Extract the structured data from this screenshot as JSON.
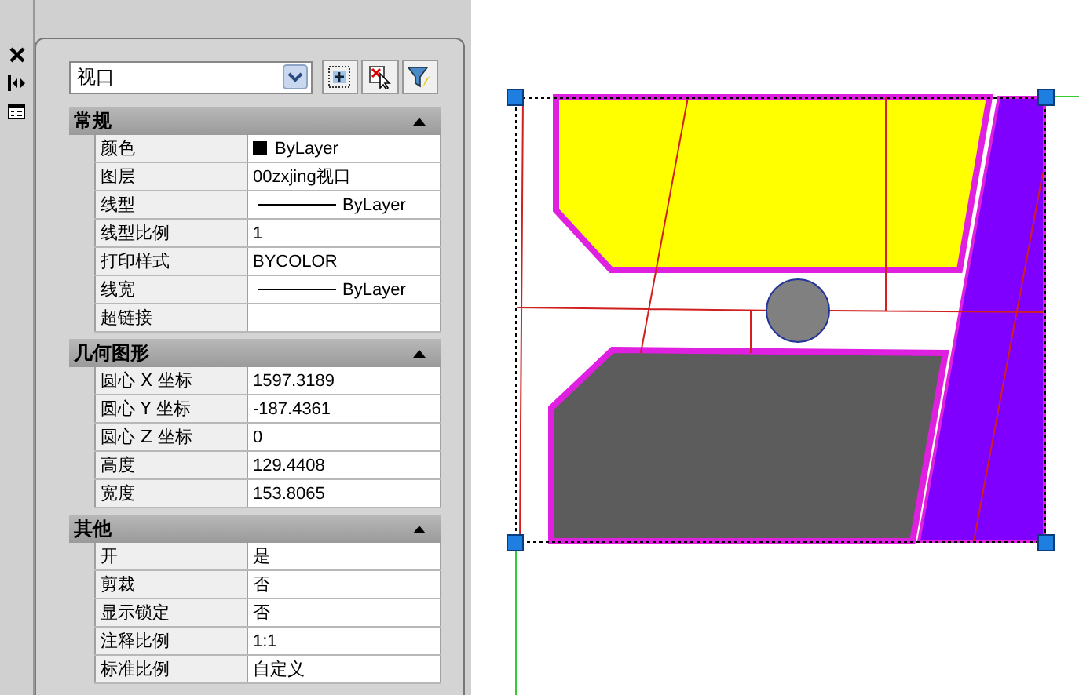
{
  "object_type": {
    "value": "视口"
  },
  "sections": [
    {
      "title": "常规",
      "expanded": true,
      "rows": [
        {
          "label": "颜色",
          "kind": "color",
          "value": "ByLayer"
        },
        {
          "label": "图层",
          "kind": "text",
          "value": "00zxjing视口"
        },
        {
          "label": "线型",
          "kind": "linetype",
          "value": "ByLayer"
        },
        {
          "label": "线型比例",
          "kind": "text",
          "value": "1"
        },
        {
          "label": "打印样式",
          "kind": "text",
          "value": "BYCOLOR"
        },
        {
          "label": "线宽",
          "kind": "linetype",
          "value": "ByLayer"
        },
        {
          "label": "超链接",
          "kind": "text",
          "value": ""
        }
      ]
    },
    {
      "title": "几何图形",
      "expanded": true,
      "rows": [
        {
          "label": "圆心 X 坐标",
          "kind": "text",
          "value": "1597.3189"
        },
        {
          "label": "圆心 Y 坐标",
          "kind": "text",
          "value": "-187.4361"
        },
        {
          "label": "圆心 Z 坐标",
          "kind": "text",
          "value": "0"
        },
        {
          "label": "高度",
          "kind": "text",
          "value": "129.4408"
        },
        {
          "label": "宽度",
          "kind": "text",
          "value": "153.8065"
        }
      ]
    },
    {
      "title": "其他",
      "expanded": true,
      "rows": [
        {
          "label": "开",
          "kind": "text",
          "value": "是"
        },
        {
          "label": "剪裁",
          "kind": "text",
          "value": "否"
        },
        {
          "label": "显示锁定",
          "kind": "text",
          "value": "否"
        },
        {
          "label": "注释比例",
          "kind": "text",
          "value": "1:1"
        },
        {
          "label": "标准比例",
          "kind": "text",
          "value": "自定义"
        }
      ]
    }
  ]
}
